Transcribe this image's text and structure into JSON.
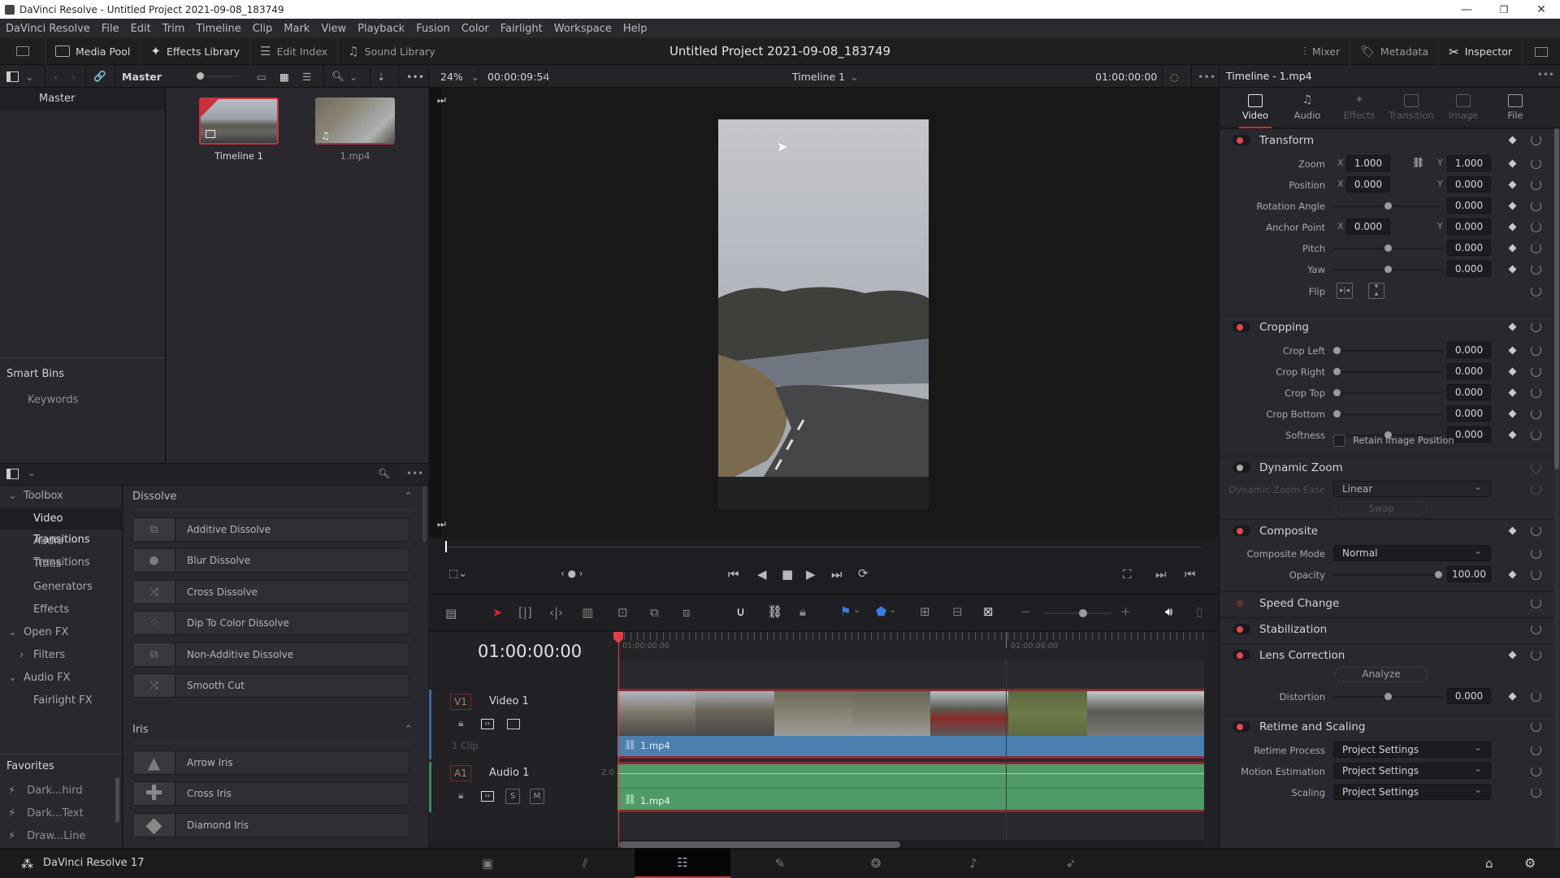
{
  "window": {
    "title": "DaVinci Resolve - Untitled Project 2021-09-08_183749",
    "controls": {
      "minimize": "—",
      "maximize": "❐",
      "close": "✕"
    }
  },
  "menu": [
    "DaVinci Resolve",
    "File",
    "Edit",
    "Trim",
    "Timeline",
    "Clip",
    "Mark",
    "View",
    "Playback",
    "Fusion",
    "Color",
    "Fairlight",
    "Workspace",
    "Help"
  ],
  "toolbar": {
    "media_pool": "Media Pool",
    "effects_library": "Effects Library",
    "edit_index": "Edit Index",
    "sound_library": "Sound Library",
    "project_title": "Untitled Project 2021-09-08_183749",
    "mixer": "Mixer",
    "metadata": "Metadata",
    "inspector": "Inspector"
  },
  "subbar": {
    "bin": "Master",
    "zoom": "24%",
    "source_timecode": "00:00:09:54",
    "timeline_name": "Timeline 1",
    "record_timecode": "01:00:00:00",
    "inspector_title": "Timeline - 1.mp4"
  },
  "media_pool": {
    "bins": [
      "Master"
    ],
    "smart_bins_label": "Smart Bins",
    "smart_bins": [
      "Keywords"
    ],
    "clips": [
      {
        "name": "Timeline 1",
        "selected": true,
        "type": "timeline"
      },
      {
        "name": "1.mp4",
        "selected": false,
        "type": "audio-video"
      }
    ]
  },
  "effects": {
    "tree": [
      {
        "label": "Toolbox",
        "level": 0,
        "expanded": true
      },
      {
        "label": "Video Transitions",
        "level": 1,
        "selected": true
      },
      {
        "label": "Audio Transitions",
        "level": 1
      },
      {
        "label": "Titles",
        "level": 1
      },
      {
        "label": "Generators",
        "level": 1
      },
      {
        "label": "Effects",
        "level": 1
      },
      {
        "label": "Open FX",
        "level": 0,
        "expanded": true
      },
      {
        "label": "Filters",
        "level": 1,
        "collapsed": true
      },
      {
        "label": "Audio FX",
        "level": 0,
        "expanded": true
      },
      {
        "label": "Fairlight FX",
        "level": 1
      }
    ],
    "favorites_label": "Favorites",
    "favorites": [
      "Dark...hird",
      "Dark...Text",
      "Draw...Line"
    ],
    "groups": [
      {
        "name": "Dissolve",
        "items": [
          "Additive Dissolve",
          "Blur Dissolve",
          "Cross Dissolve",
          "Dip To Color Dissolve",
          "Non-Additive Dissolve",
          "Smooth Cut"
        ]
      },
      {
        "name": "Iris",
        "items": [
          "Arrow Iris",
          "Cross Iris",
          "Diamond Iris"
        ]
      }
    ]
  },
  "timeline": {
    "current_timecode": "01:00:00:00",
    "ruler_marks": [
      "01:00:00:00",
      "01:00:06:00"
    ],
    "tracks": {
      "video": {
        "id": "V1",
        "name": "Video 1",
        "clip_count": "1 Clip",
        "clip": "1.mp4"
      },
      "audio": {
        "id": "A1",
        "name": "Audio 1",
        "channels": "2.0",
        "clip": "1.mp4",
        "solo": "S",
        "mute": "M"
      }
    },
    "zoom_fraction": 0.6
  },
  "inspector": {
    "tabs": [
      {
        "label": "Video",
        "state": "active"
      },
      {
        "label": "Audio",
        "state": "enabled"
      },
      {
        "label": "Effects",
        "state": "disabled"
      },
      {
        "label": "Transition",
        "state": "disabled"
      },
      {
        "label": "Image",
        "state": "disabled"
      },
      {
        "label": "File",
        "state": "enabled"
      }
    ],
    "transform": {
      "title": "Transform",
      "zoom": {
        "label": "Zoom",
        "x": "1.000",
        "y": "1.000"
      },
      "position": {
        "label": "Position",
        "x": "0.000",
        "y": "0.000"
      },
      "rotation": {
        "label": "Rotation Angle",
        "value": "0.000",
        "slider": 0.5
      },
      "anchor": {
        "label": "Anchor Point",
        "x": "0.000",
        "y": "0.000"
      },
      "pitch": {
        "label": "Pitch",
        "value": "0.000",
        "slider": 0.5
      },
      "yaw": {
        "label": "Yaw",
        "value": "0.000",
        "slider": 0.5
      },
      "flip": {
        "label": "Flip"
      }
    },
    "cropping": {
      "title": "Cropping",
      "rows": [
        {
          "label": "Crop Left",
          "value": "0.000",
          "slider": 0
        },
        {
          "label": "Crop Right",
          "value": "0.000",
          "slider": 0
        },
        {
          "label": "Crop Top",
          "value": "0.000",
          "slider": 0
        },
        {
          "label": "Crop Bottom",
          "value": "0.000",
          "slider": 0
        },
        {
          "label": "Softness",
          "value": "0.000",
          "slider": 0.5
        }
      ],
      "retain": "Retain Image Position"
    },
    "dynamic_zoom": {
      "title": "Dynamic Zoom",
      "ease_label": "Dynamic Zoom Ease",
      "ease": "Linear",
      "swap": "Swap"
    },
    "composite": {
      "title": "Composite",
      "mode_label": "Composite Mode",
      "mode": "Normal",
      "opacity_label": "Opacity",
      "opacity": "100.00",
      "slider": 1.0
    },
    "speed_change": {
      "title": "Speed Change"
    },
    "stabilization": {
      "title": "Stabilization"
    },
    "lens_correction": {
      "title": "Lens Correction",
      "analyze": "Analyze",
      "distortion_label": "Distortion",
      "distortion": "0.000",
      "slider": 0.5
    },
    "retime": {
      "title": "Retime and Scaling",
      "rows": [
        {
          "label": "Retime Process",
          "value": "Project Settings"
        },
        {
          "label": "Motion Estimation",
          "value": "Project Settings"
        },
        {
          "label": "Scaling",
          "value": "Project Settings"
        }
      ]
    }
  },
  "footer": {
    "app": "DaVinci Resolve 17",
    "pages": [
      "media",
      "cut",
      "edit",
      "fusion",
      "color",
      "fairlight",
      "deliver"
    ],
    "active_page": "edit"
  },
  "colors": {
    "accent": "#c8323a",
    "video_clip": "#4a7fae",
    "audio_clip": "#4f9b66"
  }
}
